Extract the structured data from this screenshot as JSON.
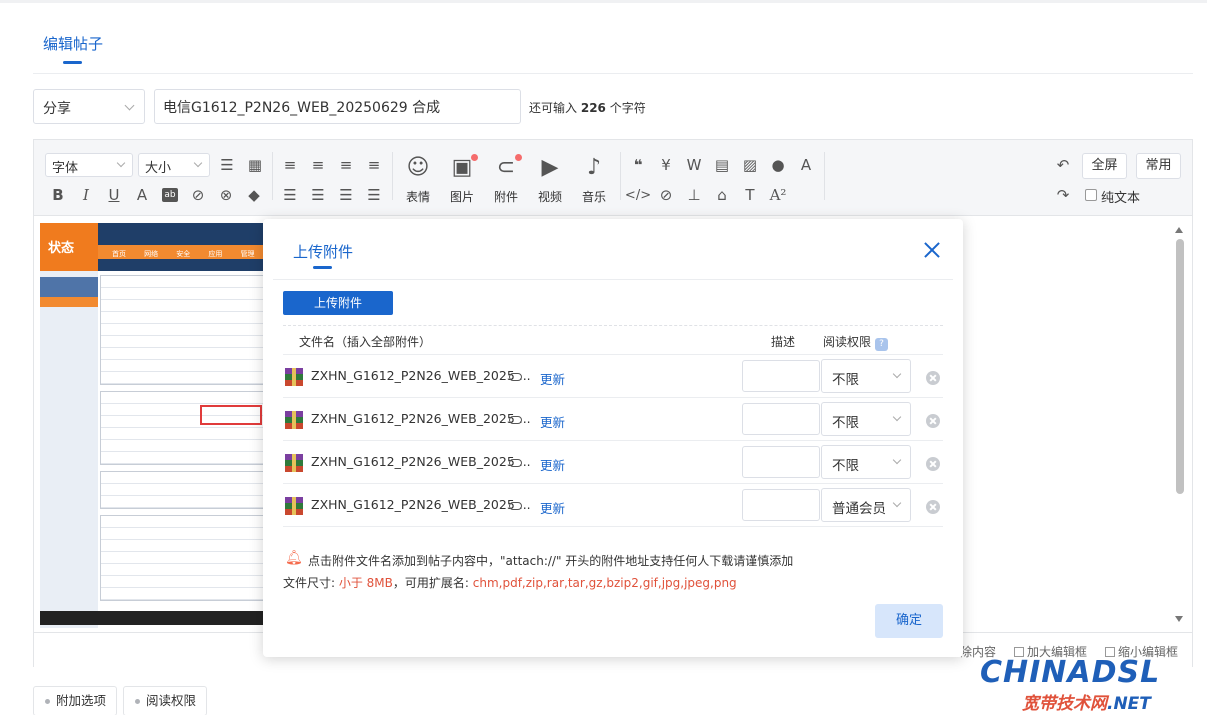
{
  "tab": {
    "title": "编辑帖子"
  },
  "post": {
    "category": "分享",
    "title_value": "电信G1612_P2N26_WEB_20250629 合成",
    "remain_prefix": "还可输入",
    "remain_count": "226",
    "remain_suffix": "个字符"
  },
  "toolbar": {
    "font_label": "字体",
    "size_label": "大小",
    "emoji": "表情",
    "image": "图片",
    "attachment": "附件",
    "video": "视频",
    "music": "音乐",
    "fullscreen": "全屏",
    "common": "常用",
    "plain_text": "纯文本"
  },
  "editor_footer": {
    "clear": "除内容",
    "enlarge": "加大编辑框",
    "shrink": "缩小编辑框"
  },
  "screenshot": {
    "status_label": "状态",
    "nav": [
      "首页",
      "网络",
      "安全",
      "应用",
      "管理"
    ]
  },
  "modal": {
    "tab": "上传附件",
    "upload_button": "上传附件",
    "col_filename": "文件名（插入全部附件）",
    "col_desc": "描述",
    "col_perm": "阅读权限",
    "help": "?",
    "files": [
      {
        "name": "ZXHN_G1612_P2N26_WEB_2025 ...",
        "update": "更新",
        "perm": "不限"
      },
      {
        "name": "ZXHN_G1612_P2N26_WEB_2025 ...",
        "update": "更新",
        "perm": "不限"
      },
      {
        "name": "ZXHN_G1612_P2N26_WEB_2025 ...",
        "update": "更新",
        "perm": "不限"
      },
      {
        "name": "ZXHN_G1612_P2N26_WEB_2025 ...",
        "update": "更新",
        "perm": "普通会员"
      }
    ],
    "notice": "点击附件文件名添加到帖子内容中，\"attach://\" 开头的附件地址支持任何人下载请谨慎添加",
    "size_label": "文件尺寸: ",
    "size_limit": "小于 8MB",
    "ext_label": "，可用扩展名: ",
    "extensions": "chm,pdf,zip,rar,tar,gz,bzip2,gif,jpg,jpeg,png",
    "confirm": "确定"
  },
  "options": {
    "extra": "附加选项",
    "permission": "阅读权限"
  },
  "watermark": {
    "brand": "CHINADSL",
    "sub_cn": "宽带技术网",
    "sub_en": ".NET"
  },
  "colors": {
    "primary": "#1a66cc",
    "danger": "#e0523b",
    "confirm_bg": "#d7e6fb"
  }
}
